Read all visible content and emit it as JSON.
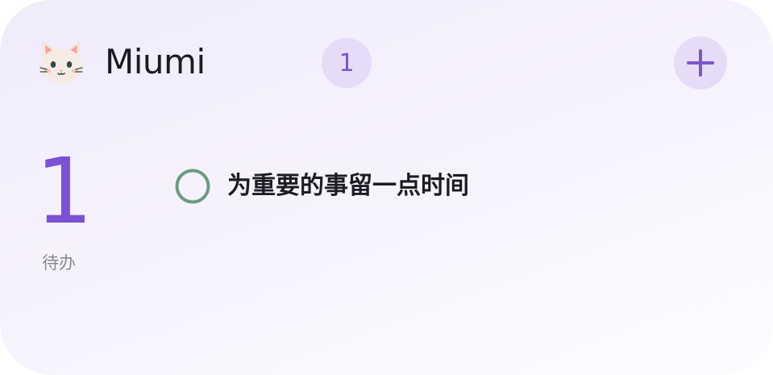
{
  "header": {
    "avatar_icon": "cat-face-icon",
    "title": "Miumi",
    "badge_count": "1",
    "add_icon": "plus-icon"
  },
  "summary": {
    "count": "1",
    "label": "待办"
  },
  "tasks": [
    {
      "text": "为重要的事留一点时间",
      "status_icon": "empty-circle-icon",
      "done": false
    }
  ],
  "colors": {
    "accent": "#7b52d4",
    "accent_soft": "#e6dcf7",
    "check_ring": "#6a9c80",
    "text": "#1c1c22",
    "muted": "#8a8890"
  }
}
